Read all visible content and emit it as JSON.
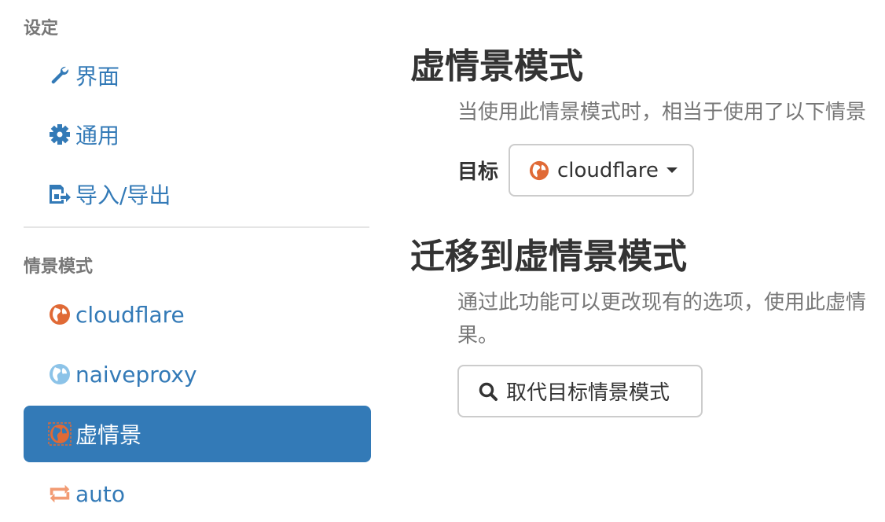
{
  "sidebar": {
    "settings_header": "设定",
    "settings_items": [
      {
        "label": "界面",
        "icon": "wrench-icon"
      },
      {
        "label": "通用",
        "icon": "gear-icon"
      },
      {
        "label": "导入/导出",
        "icon": "floppy-import-icon"
      }
    ],
    "profiles_header": "情景模式",
    "profile_items": [
      {
        "label": "cloudflare",
        "icon": "globe-orange-icon"
      },
      {
        "label": "naiveproxy",
        "icon": "globe-lightblue-icon"
      },
      {
        "label": "虚情景",
        "icon": "globe-virtual-icon",
        "active": true
      },
      {
        "label": "auto",
        "icon": "switch-arrows-icon"
      }
    ]
  },
  "main": {
    "virtual_title": "虚情景模式",
    "virtual_help": "当使用此情景模式时，相当于使用了以下情景",
    "target_label": "目标",
    "target_value": "cloudflare",
    "migrate_title": "迁移到虚情景模式",
    "migrate_help_line1": "通过此功能可以更改现有的选项，使用此虚情",
    "migrate_help_line2": "果。",
    "replace_button": "取代目标情景模式"
  },
  "colors": {
    "accent": "#337ab7",
    "orange": "#e06a36",
    "light_blue": "#8cc3e8",
    "auto_orange": "#f29b73"
  }
}
